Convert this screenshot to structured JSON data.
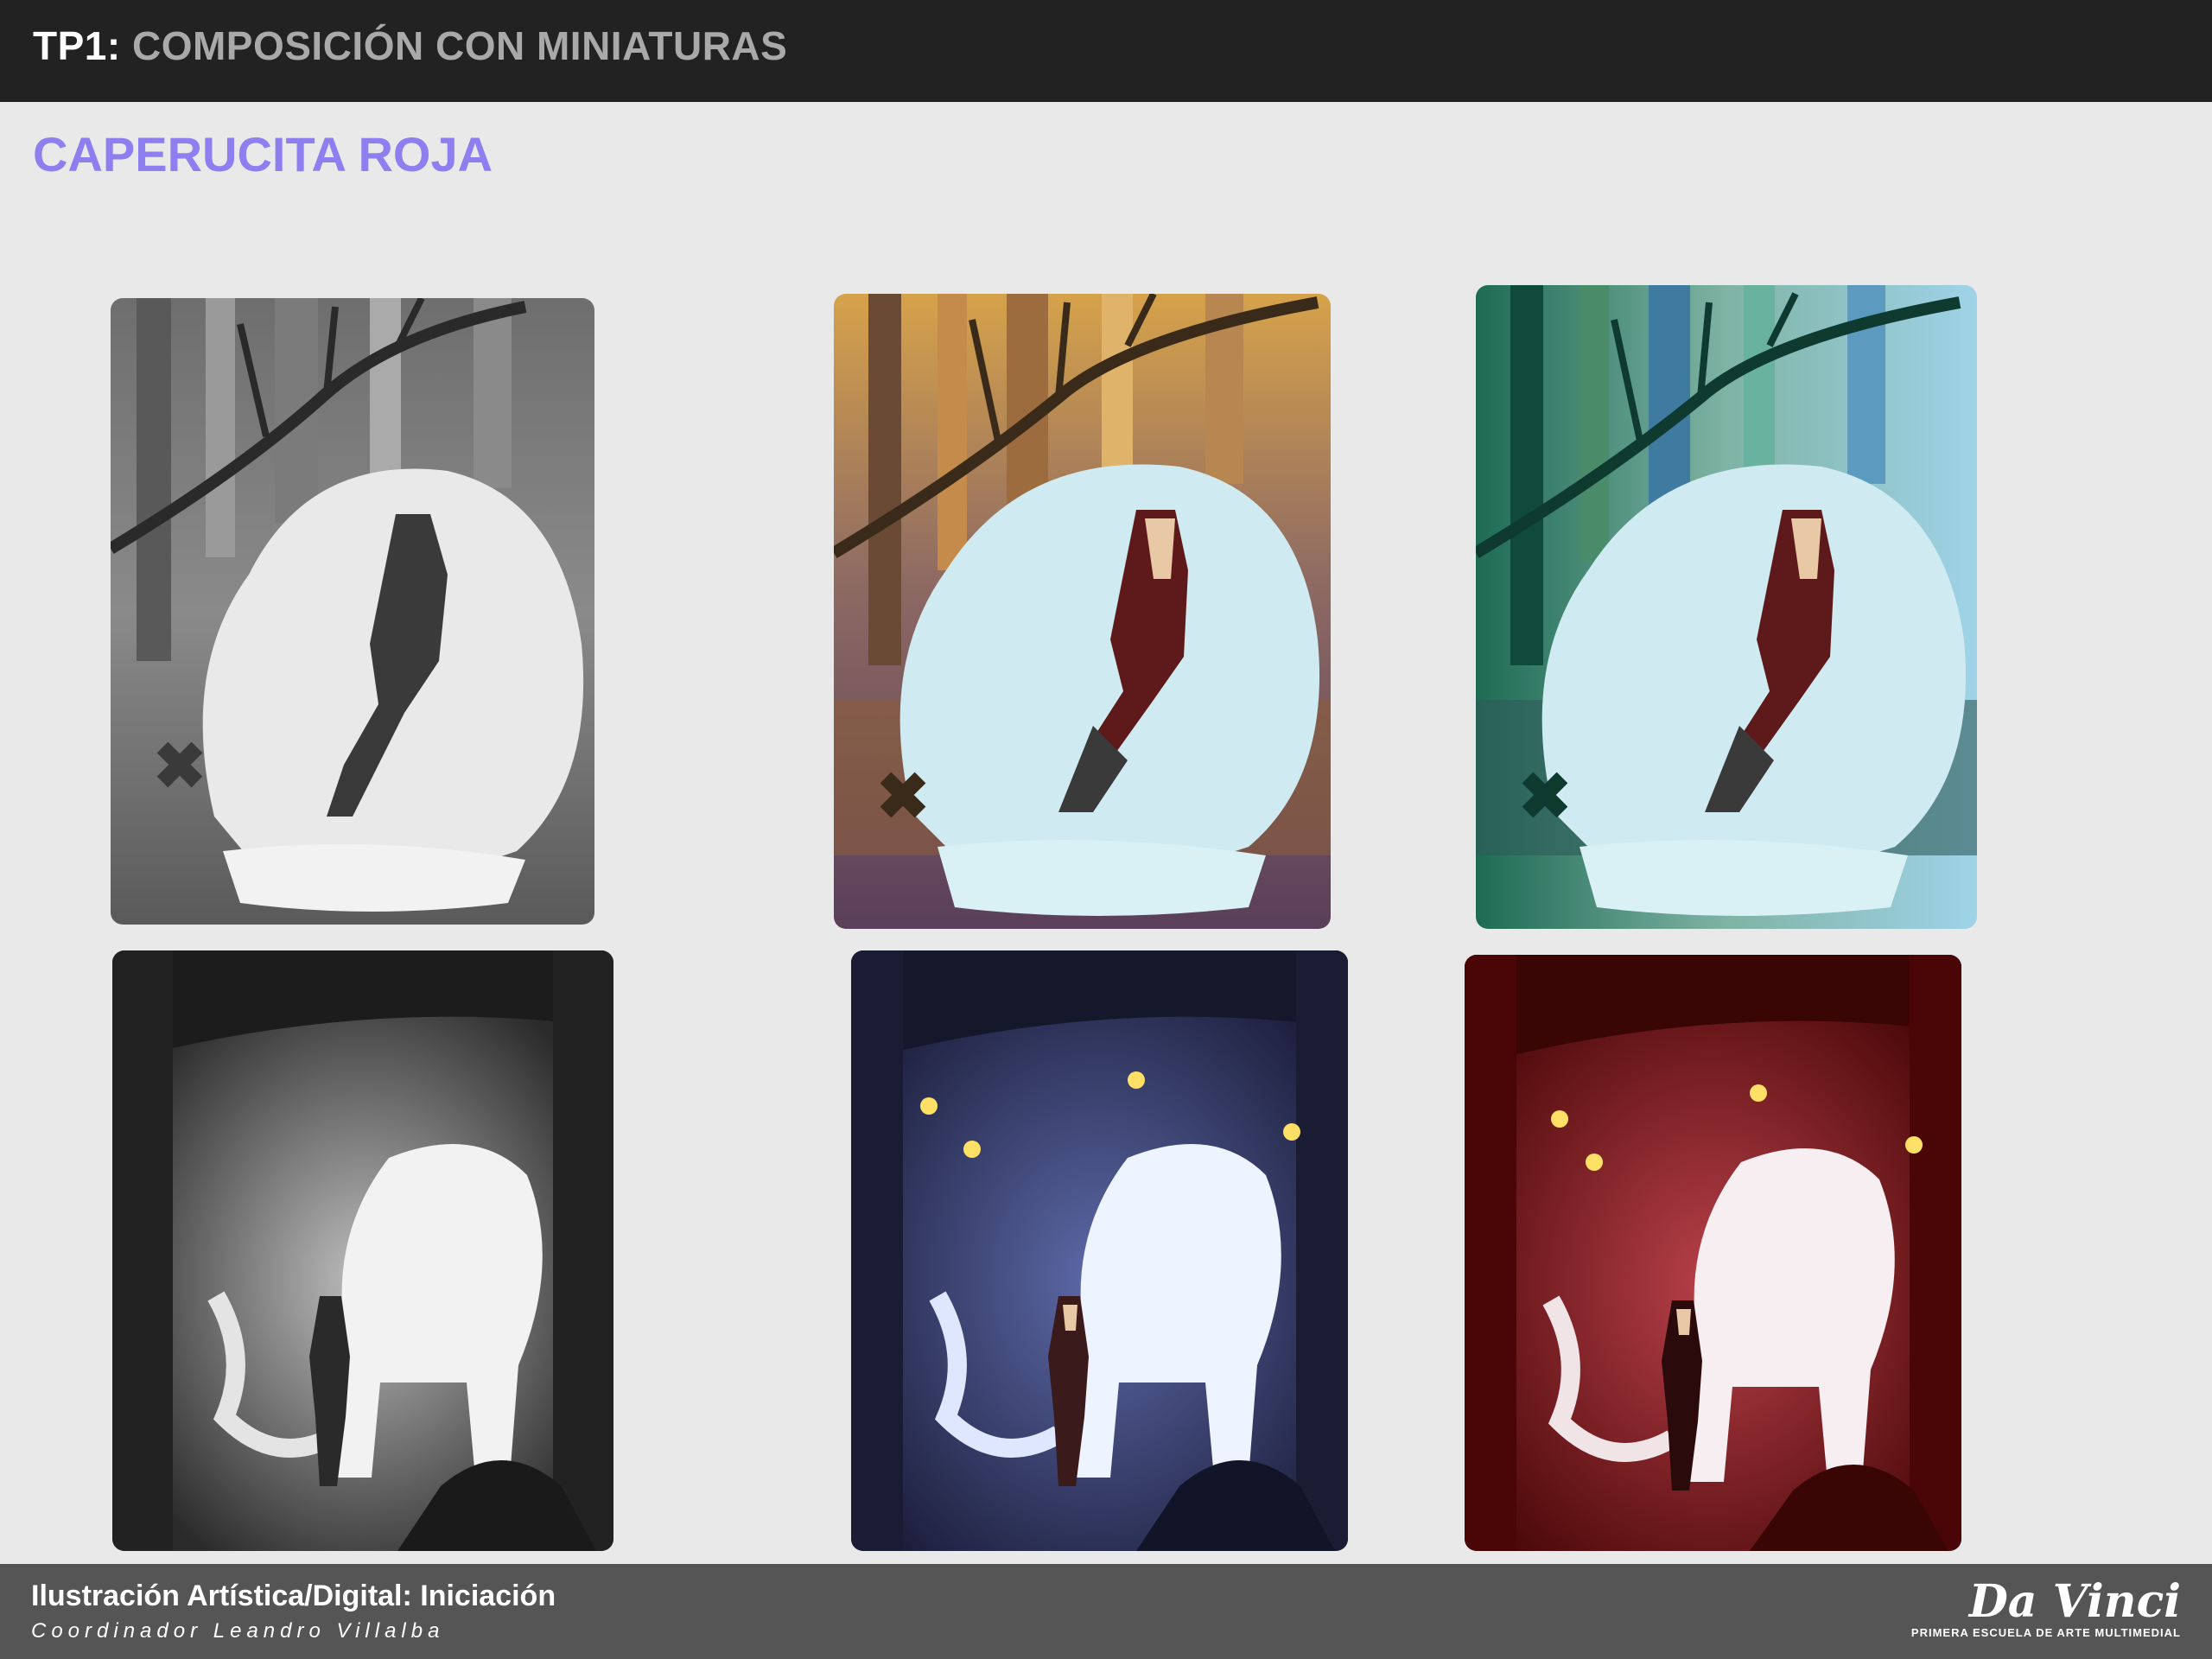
{
  "header": {
    "code": "TP1:",
    "name": "COMPOSICIÓN CON MINIATURAS"
  },
  "subtitle": "CAPERUCITA ROJA",
  "thumbnails": [
    {
      "scene": "girl-and-wolf-resting",
      "palette": "grayscale"
    },
    {
      "scene": "girl-and-wolf-resting",
      "palette": "warm-autumn"
    },
    {
      "scene": "girl-and-wolf-resting",
      "palette": "green-blue"
    },
    {
      "scene": "girl-and-wolf-standing",
      "palette": "grayscale"
    },
    {
      "scene": "girl-and-wolf-standing",
      "palette": "night-blue"
    },
    {
      "scene": "girl-and-wolf-standing",
      "palette": "crimson"
    }
  ],
  "footer": {
    "course": "Ilustración Artística/Digital: Iniciación",
    "coordinator": "Coordinador Leandro Villalba"
  },
  "logo": {
    "brand": "Da Vinci",
    "tagline": "PRIMERA ESCUELA DE ARTE MULTIMEDIAL"
  },
  "colors": {
    "header_bg": "#222222",
    "accent": "#8d7ff0",
    "footer_bg": "#555555",
    "page_bg": "#e9e9e9"
  }
}
